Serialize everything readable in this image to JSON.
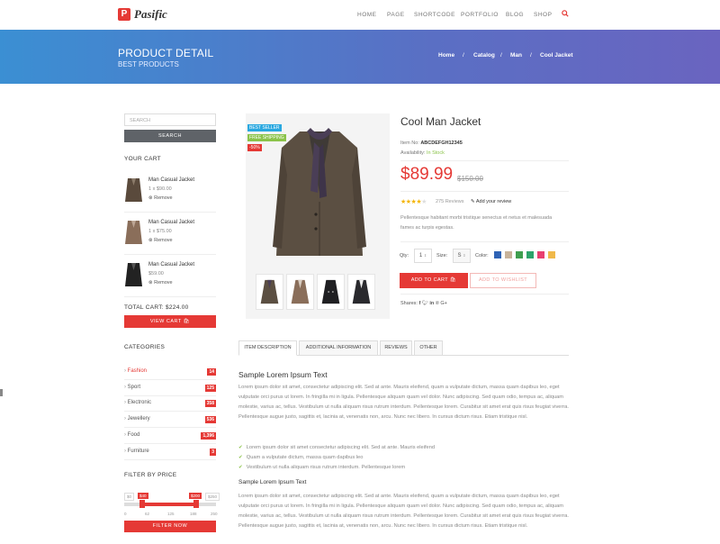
{
  "header": {
    "logo_letter": "P",
    "logo_text": "Pasific",
    "nav": [
      "HOME",
      "PAGE",
      "SHORTCODE",
      "PORTFOLIO",
      "BLOG",
      "SHOP"
    ]
  },
  "banner": {
    "title": "PRODUCT DETAIL",
    "subtitle": "BEST PRODUCTS",
    "breadcrumb": [
      "Home",
      "Catalog",
      "Man",
      "Cool Jacket"
    ],
    "sep": "/"
  },
  "sidebar": {
    "search_placeholder": "SEARCH",
    "search_button": "SEARCH",
    "cart_heading": "YOUR CART",
    "cart_items": [
      {
        "name": "Man Casual Jacket",
        "meta": "1 x $90.00",
        "remove": "Remove"
      },
      {
        "name": "Man Casual Jacket",
        "meta": "1 x $75.00",
        "remove": "Remove"
      },
      {
        "name": "Man Casual Jacket",
        "meta": "$59.00",
        "remove": "Remove"
      }
    ],
    "total": "TOTAL CART: $224.00",
    "view_cart": "VIEW CART",
    "categories_heading": "CATEGORIES",
    "categories": [
      {
        "label": "Fashion",
        "count": "14",
        "active": true
      },
      {
        "label": "Sport",
        "count": "125",
        "active": false
      },
      {
        "label": "Electronic",
        "count": "358",
        "active": false
      },
      {
        "label": "Jewellery",
        "count": "536",
        "active": false
      },
      {
        "label": "Food",
        "count": "1,396",
        "active": false
      },
      {
        "label": "Furniture",
        "count": "3",
        "active": false
      }
    ],
    "filter_heading": "FILTER BY PRICE",
    "price_labels": [
      "$0",
      "$40",
      "$200",
      "$250"
    ],
    "ticks": [
      "0",
      "62",
      "125",
      "188",
      "250"
    ],
    "filter_button": "FILTER NOW"
  },
  "product": {
    "badges": [
      "BEST SELLER",
      "FREE SHIPPING",
      "-50%"
    ],
    "title": "Cool Man Jacket",
    "item_no_label": "Item No:",
    "item_no": "ABCDEFGH12345",
    "availability_label": "Availability:",
    "availability": "In Stock",
    "price": "$89.99",
    "old_price": "$150.00",
    "rating": 4.5,
    "reviews": "275 Reviews",
    "add_review": "Add your review",
    "description": "Pellentesque habitant morbi tristique senectus et netus et malesuada fames ac turpis egestas.",
    "qty_label": "Qty:",
    "qty": "1",
    "size_label": "Size:",
    "size": "S",
    "color_label": "Color:",
    "colors": [
      "#2f63b5",
      "#c8b39a",
      "#3f9e4f",
      "#2ea36a",
      "#e84070",
      "#f0b94a"
    ],
    "add_to_cart": "ADD TO CART",
    "add_to_wishlist": "ADD TO WISHLIST",
    "share_label": "Shares:"
  },
  "tabs": [
    "ITEM DESCRIPTION",
    "ADDITIONAL INFORMATION",
    "REVIEWS",
    "OTHER"
  ],
  "content": {
    "heading": "Sample Lorem Ipsum Text",
    "para1": "Lorem ipsum dolor sit amet, consectetur adipiscing elit. Sed at ante. Mauris eleifend, quam a vulputate dictum, massa quam dapibus leo, eget vulputate orci purus ut lorem. In fringilla mi in ligula. Pellentesque aliquam quam vel dolor. Nunc adipiscing. Sed quam odio, tempus ac, aliquam molestie, varius ac, tellus. Vestibulum ut nulla aliquam risus rutrum interdum. Pellentesque lorem. Curabitur sit amet erat quis risus feugiat viverra. Pellentesque augue justo, sagittis et, lacinia at, venenatis non, arcu. Nunc nec libero. In cursus dictum risus. Etiam tristique nisl.",
    "bullets": [
      "Lorem ipsum dolor sit amet consectetur adipiscing elit. Sed at ante. Mauris eleifend",
      "Quam a vulputate dictum, massa quam dapibus leo",
      "Vestibulum ut nulla aliquam risus rutrum interdum. Pellentesque lorem"
    ],
    "heading2": "Sample Lorem Ipsum Text",
    "para2": "Lorem ipsum dolor sit amet, consectetur adipiscing elit. Sed at ante. Mauris eleifend, quam a vulputate dictum, massa quam dapibus leo, eget vulputate orci purus ut lorem. In fringilla mi in ligula. Pellentesque aliquam quam vel dolor. Nunc adipiscing. Sed quam odio, tempus ac, aliquam molestie, varius ac, tellus. Vestibulum ut nulla aliquam risus rutrum interdum. Pellentesque lorem. Curabitur sit amet erat quis risus feugiat viverra. Pellentesque augue justo, sagittis et, lacinia at, venenatis non, arcu. Nunc nec libero. In cursus dictum risus. Etiam tristique nisl."
  }
}
